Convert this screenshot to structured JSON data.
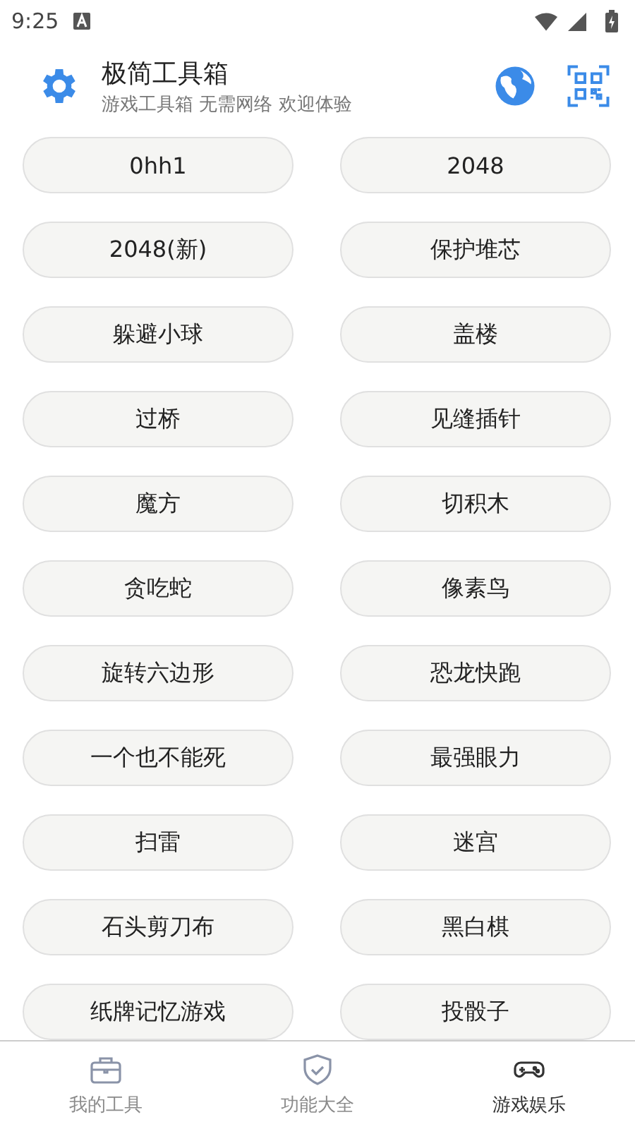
{
  "status_bar": {
    "time": "9:25"
  },
  "header": {
    "title": "极简工具箱",
    "subtitle": "游戏工具箱 无需网络 欢迎体验"
  },
  "games": [
    "0hh1",
    "2048",
    "2048(新)",
    "保护堆芯",
    "躲避小球",
    "盖楼",
    "过桥",
    "见缝插针",
    "魔方",
    "切积木",
    "贪吃蛇",
    "像素鸟",
    "旋转六边形",
    "恐龙快跑",
    "一个也不能死",
    "最强眼力",
    "扫雷",
    "迷宫",
    "石头剪刀布",
    "黑白棋",
    "纸牌记忆游戏",
    "投骰子"
  ],
  "nav": [
    {
      "label": "我的工具",
      "kind": "toolbox",
      "selected": false
    },
    {
      "label": "功能大全",
      "kind": "shield",
      "selected": false
    },
    {
      "label": "游戏娱乐",
      "kind": "gamepad",
      "selected": true
    }
  ]
}
